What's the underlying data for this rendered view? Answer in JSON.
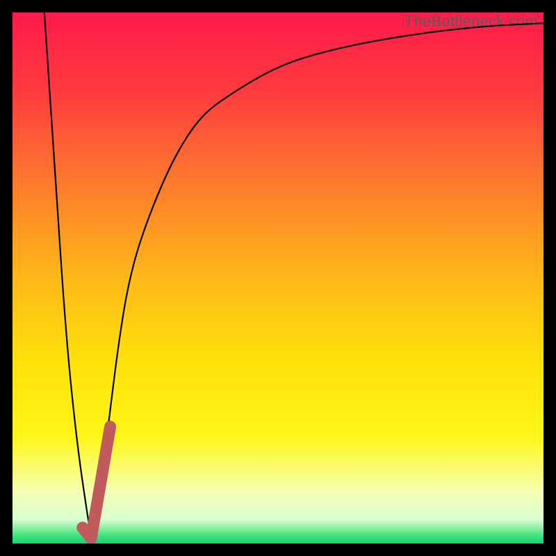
{
  "watermark": "TheBottleneck.com",
  "colors": {
    "bg_black": "#000000",
    "gradient_stops": [
      {
        "offset": 0.0,
        "color": "#ff1a4a"
      },
      {
        "offset": 0.15,
        "color": "#ff3b3e"
      },
      {
        "offset": 0.32,
        "color": "#ff7a2e"
      },
      {
        "offset": 0.5,
        "color": "#ffb818"
      },
      {
        "offset": 0.66,
        "color": "#ffe20a"
      },
      {
        "offset": 0.8,
        "color": "#fff61a"
      },
      {
        "offset": 0.9,
        "color": "#f7ffb0"
      },
      {
        "offset": 0.955,
        "color": "#d8ffd2"
      },
      {
        "offset": 0.985,
        "color": "#42e37c"
      },
      {
        "offset": 1.0,
        "color": "#17d36a"
      }
    ],
    "curve_stroke": "#000000",
    "hockey_stroke": "#c15a5c"
  },
  "chart_data": {
    "type": "line",
    "title": "",
    "xlabel": "",
    "ylabel": "",
    "xlim": [
      0,
      100
    ],
    "ylim": [
      0,
      100
    ],
    "series": [
      {
        "name": "bottleneck-curve",
        "x": [
          6,
          8,
          10,
          12,
          14,
          15,
          16,
          18,
          20,
          22,
          25,
          30,
          35,
          40,
          50,
          60,
          70,
          80,
          90,
          100
        ],
        "y": [
          100,
          70,
          40,
          20,
          6,
          0,
          6,
          22,
          38,
          50,
          60,
          72,
          80,
          84,
          90,
          93,
          95,
          96.5,
          97.5,
          98
        ]
      },
      {
        "name": "hockey-mark",
        "x": [
          13.2,
          14.8,
          18.4
        ],
        "y": [
          3.0,
          1.0,
          22.0
        ]
      }
    ]
  }
}
